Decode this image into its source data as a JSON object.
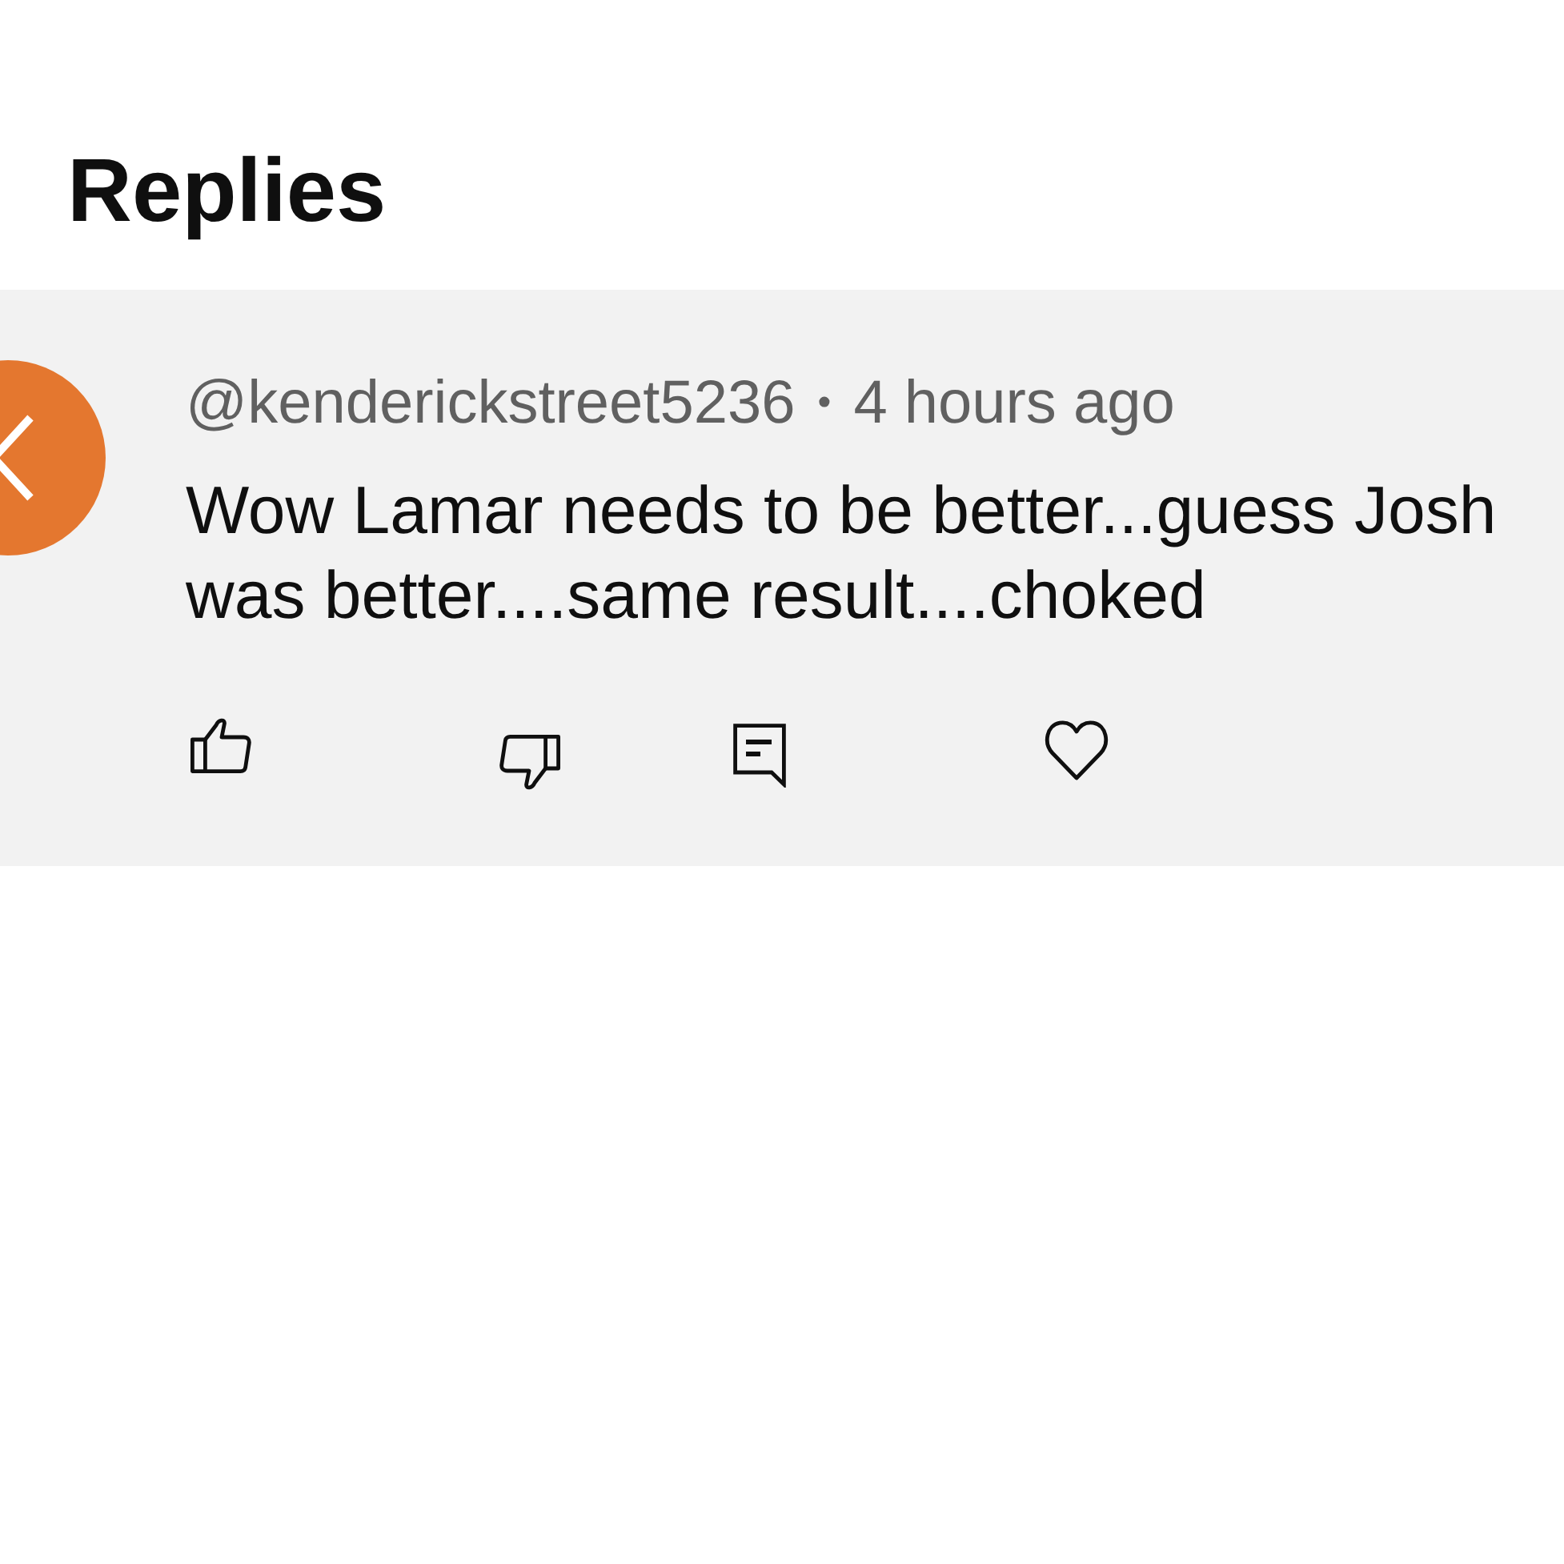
{
  "title": "Replies",
  "reply": {
    "author": "@kenderickstreet5236",
    "separator": "•",
    "time": "4 hours ago",
    "text": "Wow Lamar needs to be better...guess Josh was better....same result....choked",
    "actions": [
      {
        "kind": "like"
      },
      {
        "kind": "dislike"
      },
      {
        "kind": "reply"
      },
      {
        "kind": "heart"
      }
    ]
  }
}
